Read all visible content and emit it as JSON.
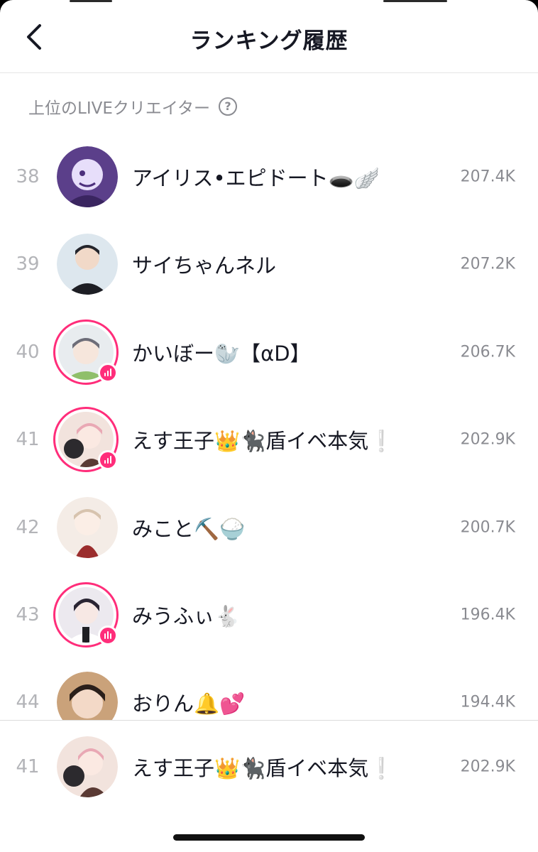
{
  "header": {
    "title": "ランキング履歴"
  },
  "section": {
    "label": "上位のLIVEクリエイター",
    "help_icon": "?"
  },
  "rows": [
    {
      "rank": "38",
      "name": "アイリス•エピドート🕳️🪽",
      "score": "207.4K",
      "live": false,
      "avatar_color": "#5b3f8a"
    },
    {
      "rank": "39",
      "name": "サイちゃんネル",
      "score": "207.2K",
      "live": false,
      "avatar_color": "#dde7ee"
    },
    {
      "rank": "40",
      "name": "かいぼー🦭【αD】",
      "score": "206.7K",
      "live": true,
      "avatar_color": "#e8ecef"
    },
    {
      "rank": "41",
      "name": "えす王子👑🐈‍⬛盾イベ本気❕",
      "score": "202.9K",
      "live": true,
      "avatar_color": "#f2e3dd"
    },
    {
      "rank": "42",
      "name": "みこと⛏️🍚",
      "score": "200.7K",
      "live": false,
      "avatar_color": "#f4ece6"
    },
    {
      "rank": "43",
      "name": "みうふぃ🐇",
      "score": "196.4K",
      "live": true,
      "avatar_color": "#ece9ef"
    },
    {
      "rank": "44",
      "name": "おりん🔔💕",
      "score": "194.4K",
      "live": false,
      "avatar_color": "#caa27a"
    }
  ],
  "pinned": {
    "rank": "41",
    "name": "えす王子👑🐈‍⬛盾イベ本気❕",
    "score": "202.9K",
    "avatar_color": "#f2e3dd"
  },
  "colors": {
    "live_ring": "#ff2d7a",
    "rank_text": "#b3b4b8",
    "secondary_text": "#8a8b91"
  }
}
